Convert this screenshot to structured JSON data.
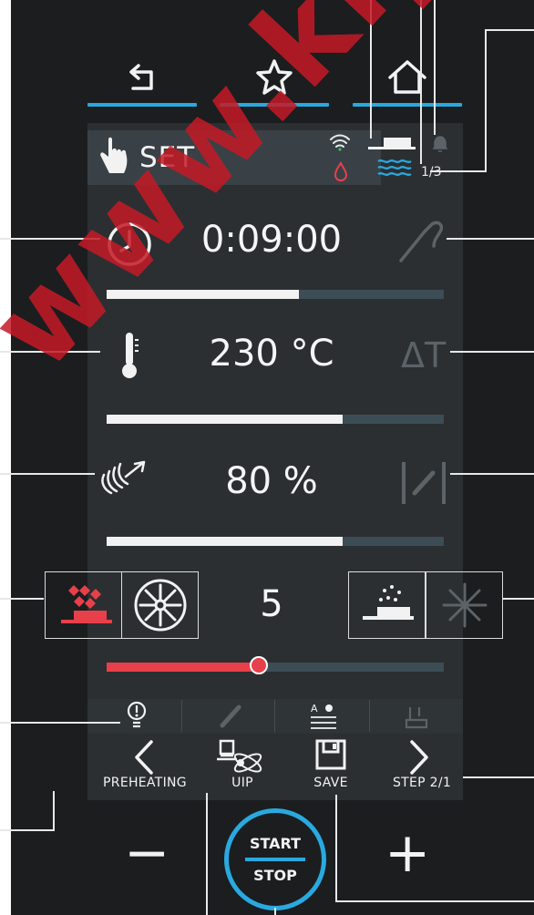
{
  "nav": {
    "back_icon": "back-icon",
    "favorite_icon": "star-icon",
    "home_icon": "home-icon"
  },
  "header": {
    "mode_label": "SET",
    "step_counter": "1/3"
  },
  "time": {
    "value": "0:09:00",
    "level": 0.57
  },
  "temperature": {
    "value": "230 °C",
    "delta_label": "ΔT",
    "level": 0.7
  },
  "humidity": {
    "value": "80 %",
    "level": 0.7
  },
  "fan": {
    "value": "5",
    "level": 0.45
  },
  "bottom": {
    "preheating_label": "PREHEATING",
    "uip_label": "UIP",
    "save_label": "SAVE",
    "step_label": "STEP 2/1"
  },
  "start_stop": {
    "start_label": "START",
    "stop_label": "STOP"
  },
  "minus_label": "−",
  "plus_label": "+",
  "watermark": "www.kiy-v.",
  "colors": {
    "accent": "#29a9e0",
    "alert": "#e8404a",
    "screen_bg": "#2b2f32",
    "device_bg": "#1b1d1f"
  }
}
